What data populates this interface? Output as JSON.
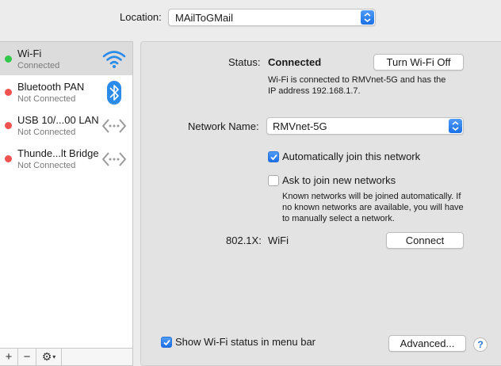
{
  "location": {
    "label": "Location:",
    "value": "MAilToGMail"
  },
  "services": [
    {
      "name": "Wi-Fi",
      "status": "Connected",
      "dot": "#34c84a",
      "icon": "wifi-icon"
    },
    {
      "name": "Bluetooth PAN",
      "status": "Not Connected",
      "dot": "#f0524f",
      "icon": "bluetooth-icon"
    },
    {
      "name": "USB 10/...00 LAN",
      "status": "Not Connected",
      "dot": "#f0524f",
      "icon": "ethernet-icon"
    },
    {
      "name": "Thunde...lt Bridge",
      "status": "Not Connected",
      "dot": "#f0524f",
      "icon": "ethernet-icon"
    }
  ],
  "toolbar": {
    "add": "+",
    "remove": "−",
    "gear": "⚙"
  },
  "main": {
    "status_label": "Status:",
    "status_value": "Connected",
    "turn_off_button": "Turn Wi-Fi Off",
    "status_desc_line1": "Wi-Fi is connected to RMVnet-5G and has the",
    "status_desc_line2": "IP address 192.168.1.7.",
    "network_name_label": "Network Name:",
    "network_name_value": "RMVnet-5G",
    "auto_join_label": "Automatically join this network",
    "auto_join_checked": true,
    "ask_join_label": "Ask to join new networks",
    "ask_join_checked": false,
    "ask_desc_line1": "Known networks will be joined automatically. If",
    "ask_desc_line2": "no known networks are available, you will have",
    "ask_desc_line3": "to manually select a network.",
    "dot1x_label": "802.1X:",
    "dot1x_value": "WiFi",
    "connect_button": "Connect",
    "show_status_label": "Show Wi-Fi status in menu bar",
    "show_status_checked": true,
    "advanced_button": "Advanced...",
    "help_button": "?"
  },
  "colors": {
    "accent": "#1a6fe8",
    "connected": "#34c84a",
    "disconnected": "#f0524f"
  }
}
